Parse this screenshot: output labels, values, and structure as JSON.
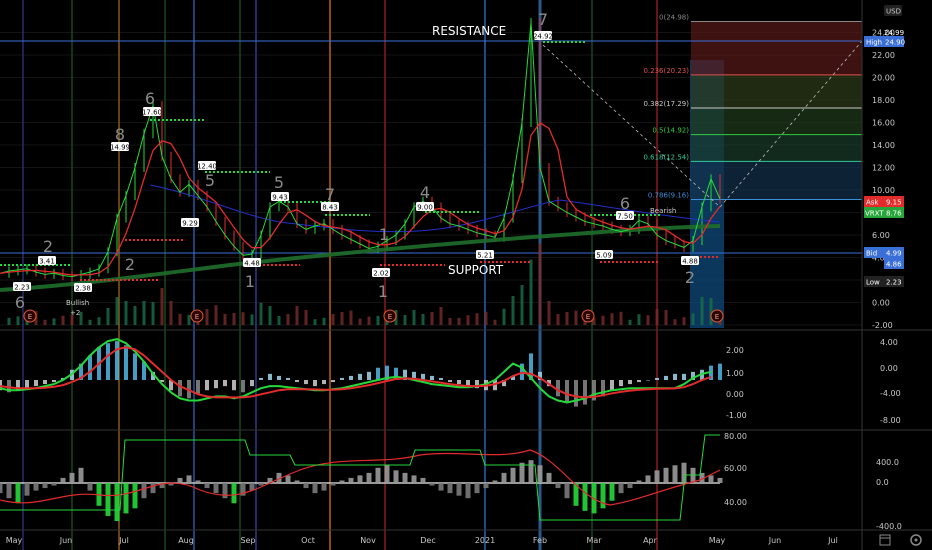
{
  "currency": "USD",
  "annotations": {
    "resistance": "RESISTANCE",
    "support": "SUPPORT",
    "bullish": "Bullish",
    "bullish_sub": "+2",
    "bearish": "Bearish"
  },
  "colors": {
    "up": "#26d93a",
    "down": "#e32b2b",
    "fib_line": "#3a6fd8",
    "grid": "#141414"
  },
  "chart_data": [
    {
      "type": "line",
      "panel": "price",
      "x_labels": [
        "May",
        "Jun",
        "Jul",
        "Aug",
        "Sep",
        "Oct",
        "Nov",
        "Dec",
        "2021",
        "Feb",
        "Mar",
        "Apr",
        "May",
        "Jun",
        "Jul"
      ],
      "ylim": [
        -2,
        26
      ],
      "y_ticks": [
        -2,
        0,
        2,
        4,
        6,
        8,
        10,
        12,
        14,
        16,
        18,
        20,
        22,
        24
      ],
      "y_tick_labels": [
        "-2.00",
        "0.00",
        "2.00",
        "4.00",
        "6.00",
        "8.00",
        "10.00",
        "12.00",
        "14.00",
        "16.00",
        "18.00",
        "20.00",
        "22.00",
        "24.00"
      ],
      "series": [
        {
          "values": [
            2.6,
            2.8,
            2.9,
            3.0,
            2.7,
            2.5,
            2.6,
            2.4,
            2.3,
            2.5,
            2.7,
            3.0,
            4.5,
            7.5,
            9.5,
            12,
            15,
            17.5,
            13,
            11,
            9.8,
            10.5,
            9.5,
            8.5,
            7.2,
            6.0,
            5.0,
            4.2,
            4.3,
            6,
            8.5,
            9,
            8.5,
            7,
            6.5,
            6.8,
            7.0,
            6.5,
            6.0,
            5.6,
            5.2,
            4.8,
            5.0,
            5.5,
            6.0,
            7.0,
            8.5,
            9.0,
            8.5,
            7.5,
            7.0,
            6.8,
            6.5,
            6.2,
            6.0,
            5.8,
            7.5,
            11,
            16,
            24.9,
            12,
            9,
            8.5,
            8.0,
            7.6,
            7.2,
            7.0,
            6.8,
            6.5,
            6.3,
            6.5,
            7.3,
            7.0,
            6.0,
            5.5,
            5.2,
            4.9,
            5.5,
            8.5,
            11,
            9.2
          ]
        }
      ],
      "price_tags": [
        "2.23",
        "3.41",
        "2.38",
        "14.99",
        "17.60",
        "12.40",
        "9.29",
        "4.48",
        "9.43",
        "8.43",
        "2.02",
        "9.00",
        "5.21",
        "24.92",
        "7.50",
        "5.09",
        "4.88"
      ],
      "axis_badges": {
        "high_label": "High",
        "high_value": "24.90",
        "top_value": "24.99",
        "ask_label": "Ask",
        "ask_value": "9.15",
        "vrxt_label": "VRXT",
        "vrxt_value": "8.76",
        "bid_label": "Bid",
        "bid_value": "4.99",
        "bid_value2": "4.86",
        "low_label": "Low",
        "low_value": "2.23"
      },
      "fib_levels": [
        {
          "label": "0(24.98)",
          "value": 24.98,
          "color": "#888888"
        },
        {
          "label": "0.236(20.23)",
          "value": 20.23,
          "color": "#e05050"
        },
        {
          "label": "0.382(17.29)",
          "value": 17.29,
          "color": "#c8c8c8"
        },
        {
          "label": "0.5(14.92)",
          "value": 14.92,
          "color": "#2ecc40"
        },
        {
          "label": "0.618(12.54)",
          "value": 12.54,
          "color": "#2ecc9a"
        },
        {
          "label": "0.786(9.16)",
          "value": 9.16,
          "color": "#3a8fd8"
        }
      ],
      "counts": [
        "6",
        "8",
        "7",
        "6",
        "5",
        "2",
        "1",
        "1",
        "2",
        "7",
        "6",
        "2",
        "4",
        "1",
        "5"
      ]
    },
    {
      "type": "bar",
      "panel": "macd",
      "ylim": [
        -8,
        4
      ],
      "y_ticks": [
        4,
        0,
        -4,
        -8
      ],
      "y_tick_labels": [
        "4.00",
        "0.00",
        "-4.00",
        "-8.00"
      ],
      "y_ticks_inner": [
        "2.00",
        "1.00",
        "0.00",
        "-1.00"
      ],
      "histogram": [
        -0.5,
        -0.6,
        -0.5,
        -0.4,
        -0.3,
        -0.2,
        -0.1,
        0.1,
        0.5,
        0.8,
        1.2,
        1.6,
        1.8,
        1.9,
        1.7,
        1.3,
        0.9,
        0.4,
        -0.1,
        -0.5,
        -0.8,
        -0.9,
        -0.7,
        -0.5,
        -0.4,
        -0.3,
        -0.5,
        -0.6,
        -0.3,
        0.1,
        0.3,
        0.2,
        0.1,
        -0.1,
        -0.2,
        -0.3,
        -0.2,
        -0.1,
        0.1,
        0.2,
        0.3,
        0.4,
        0.6,
        0.7,
        0.6,
        0.5,
        0.4,
        0.3,
        0.2,
        0.1,
        -0.1,
        -0.2,
        -0.3,
        -0.4,
        -0.5,
        -0.5,
        -0.3,
        0.2,
        0.8,
        1.3,
        0.4,
        -0.3,
        -0.8,
        -1.1,
        -1.3,
        -1.2,
        -1.0,
        -0.8,
        -0.5,
        -0.3,
        -0.2,
        -0.1,
        0.0,
        0.1,
        0.2,
        0.3,
        0.3,
        0.4,
        0.5,
        0.7,
        0.8
      ],
      "macd_line": [
        -0.4,
        -0.5,
        -0.5,
        -0.45,
        -0.4,
        -0.3,
        -0.2,
        0.0,
        0.3,
        0.7,
        1.2,
        1.6,
        1.9,
        2.0,
        1.8,
        1.4,
        0.9,
        0.3,
        -0.2,
        -0.6,
        -0.9,
        -1.0,
        -1.0,
        -0.9,
        -0.8,
        -0.8,
        -0.9,
        -0.8,
        -0.6,
        -0.4,
        -0.3,
        -0.3,
        -0.35,
        -0.4,
        -0.45,
        -0.5,
        -0.5,
        -0.45,
        -0.4,
        -0.3,
        -0.2,
        -0.1,
        0.0,
        0.1,
        0.15,
        0.1,
        0.0,
        -0.1,
        -0.2,
        -0.25,
        -0.3,
        -0.35,
        -0.35,
        -0.3,
        -0.2,
        0.0,
        0.4,
        0.8,
        0.6,
        0.1,
        -0.4,
        -0.8,
        -1.0,
        -1.1,
        -1.0,
        -0.9,
        -0.7,
        -0.6,
        -0.5,
        -0.45,
        -0.4,
        -0.4,
        -0.4,
        -0.4,
        -0.4,
        -0.4,
        -0.2,
        0.1,
        0.3,
        0.4
      ],
      "signal_line": [
        -0.3,
        -0.35,
        -0.4,
        -0.4,
        -0.4,
        -0.38,
        -0.33,
        -0.25,
        -0.1,
        0.1,
        0.4,
        0.8,
        1.2,
        1.5,
        1.6,
        1.5,
        1.2,
        0.8,
        0.4,
        0.0,
        -0.3,
        -0.5,
        -0.7,
        -0.8,
        -0.85,
        -0.85,
        -0.85,
        -0.85,
        -0.8,
        -0.7,
        -0.6,
        -0.5,
        -0.45,
        -0.45,
        -0.45,
        -0.46,
        -0.48,
        -0.48,
        -0.45,
        -0.4,
        -0.33,
        -0.25,
        -0.15,
        -0.05,
        0.05,
        0.08,
        0.06,
        0.0,
        -0.07,
        -0.13,
        -0.2,
        -0.26,
        -0.3,
        -0.3,
        -0.28,
        -0.2,
        -0.05,
        0.2,
        0.35,
        0.3,
        0.1,
        -0.2,
        -0.5,
        -0.7,
        -0.8,
        -0.85,
        -0.82,
        -0.75,
        -0.65,
        -0.58,
        -0.52,
        -0.48,
        -0.45,
        -0.43,
        -0.42,
        -0.41,
        -0.35,
        -0.2,
        0.0,
        0.15
      ]
    },
    {
      "type": "bar",
      "panel": "oscillator",
      "ylim": [
        -400,
        400
      ],
      "y_ticks": [
        400,
        0,
        -400
      ],
      "y_tick_labels": [
        "400.0",
        "0.0",
        "-400.0"
      ],
      "y_ticks_inner": [
        "80.00",
        "60.00",
        "40.00"
      ],
      "histogram": [
        -40,
        -60,
        -80,
        -50,
        -30,
        -20,
        -10,
        20,
        40,
        60,
        -30,
        -90,
        -130,
        -150,
        -120,
        -100,
        -60,
        -40,
        -20,
        -10,
        20,
        30,
        10,
        -20,
        -40,
        -60,
        -80,
        -50,
        -30,
        -10,
        20,
        40,
        30,
        10,
        -20,
        -40,
        -30,
        -10,
        10,
        20,
        30,
        40,
        60,
        70,
        50,
        40,
        30,
        20,
        -10,
        -30,
        -40,
        -50,
        -60,
        -40,
        -20,
        10,
        40,
        60,
        80,
        90,
        70,
        40,
        -20,
        -60,
        -90,
        -110,
        -120,
        -100,
        -70,
        -40,
        -20,
        10,
        30,
        50,
        60,
        70,
        80,
        60,
        40,
        30,
        20
      ]
    }
  ]
}
